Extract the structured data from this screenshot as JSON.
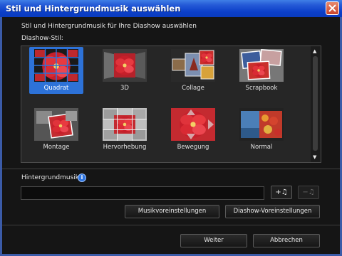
{
  "window": {
    "title": "Stil und Hintergrundmusik auswählen",
    "close_icon": "close-icon"
  },
  "instruction": "Stil und Hintergrundmusik für Ihre Diashow auswählen",
  "style_label": "Diashow-Stil:",
  "styles": [
    {
      "label": "Quadrat",
      "selected": true
    },
    {
      "label": "3D",
      "selected": false
    },
    {
      "label": "Collage",
      "selected": false
    },
    {
      "label": "Scrapbook",
      "selected": false
    },
    {
      "label": "Montage",
      "selected": false
    },
    {
      "label": "Hervorhebung",
      "selected": false
    },
    {
      "label": "Bewegung",
      "selected": false
    },
    {
      "label": "Normal",
      "selected": false
    }
  ],
  "scrollbar": {
    "up_icon": "▲",
    "down_icon": "▼"
  },
  "music": {
    "label": "Hintergrundmusik:",
    "info_icon": "i",
    "value": "",
    "add_icon": "+♫",
    "remove_icon": "−♫"
  },
  "buttons": {
    "music_settings": "Musikvoreinstellungen",
    "slideshow_settings": "Diashow-Voreinstellungen",
    "next": "Weiter",
    "cancel": "Abbrechen"
  },
  "colors": {
    "titlebar": "#0b3fc9",
    "selection": "#2d72d8",
    "background": "#151515",
    "flower_red": "#d8262e"
  }
}
